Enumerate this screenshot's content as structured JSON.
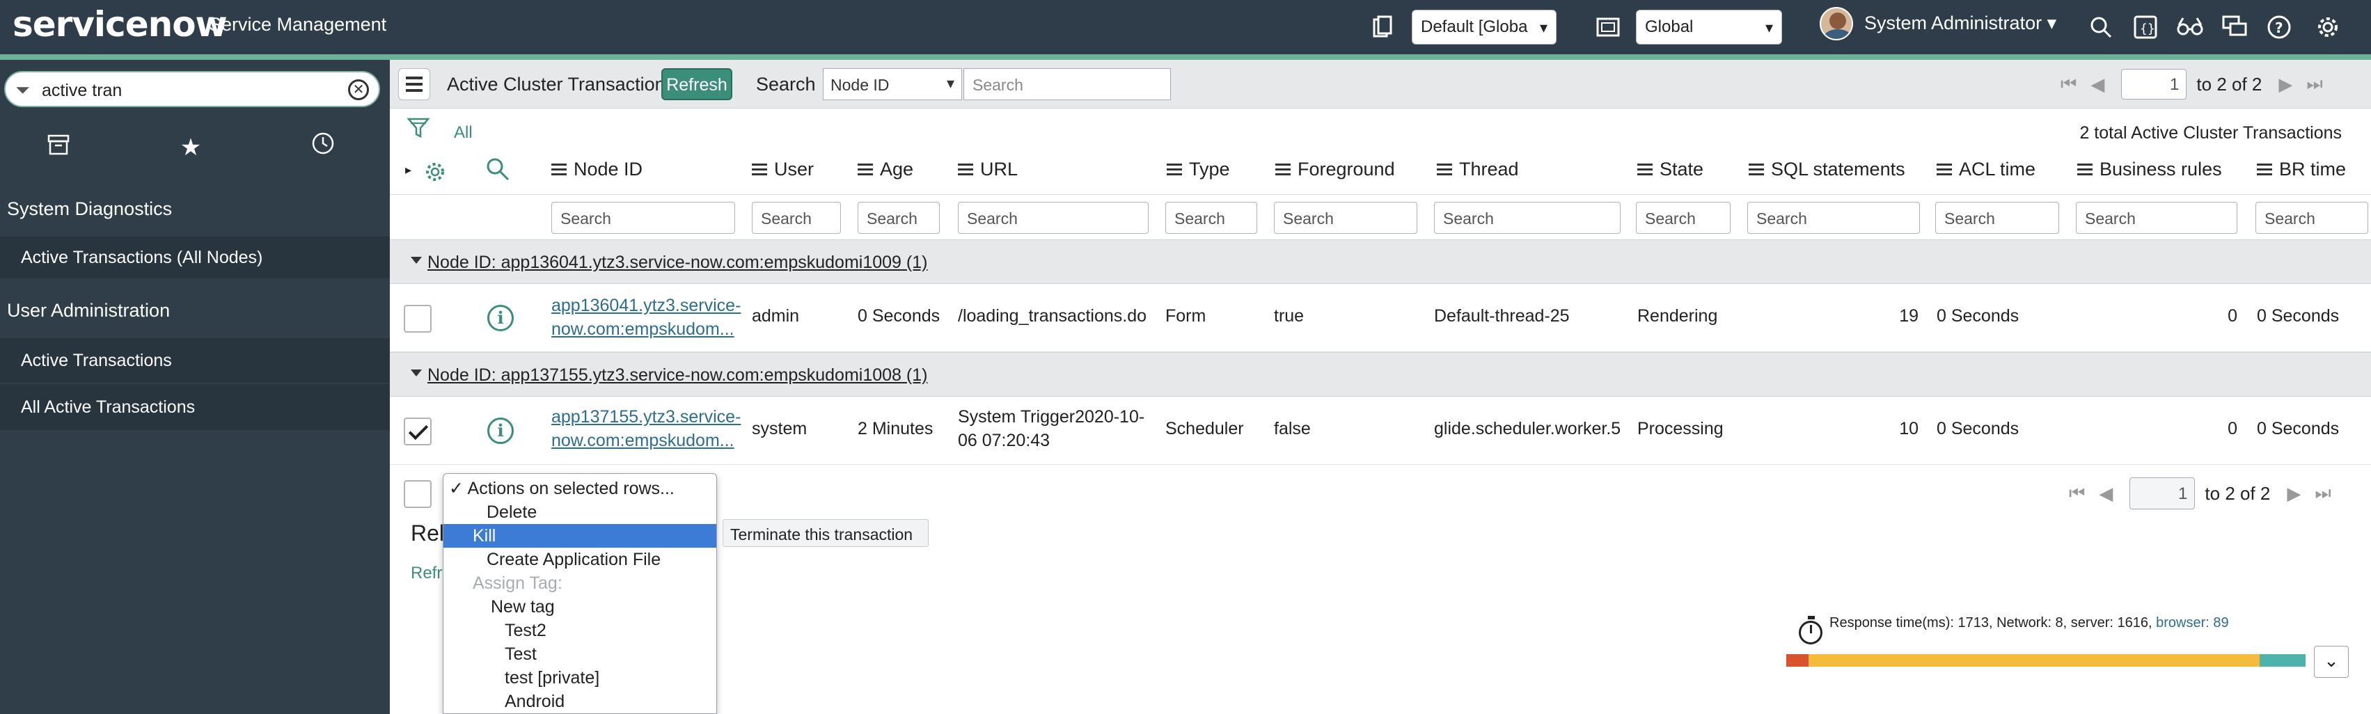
{
  "app": {
    "brand": "servicenow",
    "title": "Service Management",
    "update_set": "Default [Globa",
    "scope": "Global",
    "user": "System Administrator"
  },
  "sidebar": {
    "filter_value": "active tran",
    "sections": [
      {
        "label": "System Diagnostics",
        "modules": [
          "Active Transactions (All Nodes)"
        ]
      },
      {
        "label": "User Administration",
        "modules": [
          "Active Transactions",
          "All Active Transactions"
        ]
      }
    ]
  },
  "list": {
    "title": "Active Cluster Transactions",
    "refresh_label": "Refresh",
    "search_label": "Search",
    "search_field": "Node ID",
    "search_placeholder": "Search",
    "page_current": "1",
    "page_of": "to 2 of 2",
    "breadcrumb_all": "All",
    "total_text": "2   total Active Cluster Transactions",
    "columns": [
      "Node ID",
      "User",
      "Age",
      "URL",
      "Type",
      "Foreground",
      "Thread",
      "State",
      "SQL statements",
      "ACL time",
      "Business rules",
      "BR time"
    ],
    "column_search_placeholder": "Search",
    "groups": [
      {
        "label": "Node ID: app136041.ytz3.service-now.com:empskudomi1009 (1)",
        "row": {
          "checked": false,
          "node_id_line1": "app136041.ytz3.service-",
          "node_id_line2": "now.com:empskudom...",
          "user": "admin",
          "age": "0 Seconds",
          "url": "/loading_transactions.do",
          "url_line2": "",
          "type": "Form",
          "foreground": "true",
          "thread": "Default-thread-25",
          "state": "Rendering",
          "sql": "19",
          "acl": "0 Seconds",
          "business_rules": "0",
          "br_time": "0 Seconds"
        }
      },
      {
        "label": "Node ID: app137155.ytz3.service-now.com:empskudomi1008 (1)",
        "row": {
          "checked": true,
          "node_id_line1": "app137155.ytz3.service-",
          "node_id_line2": "now.com:empskudom...",
          "user": "system",
          "age": "2 Minutes",
          "url": "System Trigger2020-10-",
          "url_line2": "06 07:20:43",
          "type": "Scheduler",
          "foreground": "false",
          "thread": "glide.scheduler.worker.5",
          "state": "Processing",
          "sql": "10",
          "acl": "0 Seconds",
          "business_rules": "0",
          "br_time": "0 Seconds"
        }
      }
    ]
  },
  "actions_menu": {
    "items": [
      {
        "label": "Actions on selected rows...",
        "checked": true,
        "state": "normal"
      },
      {
        "label": "Delete",
        "state": "normal"
      },
      {
        "label": "Kill",
        "state": "selected"
      },
      {
        "label": "Create Application File",
        "state": "normal"
      },
      {
        "label": "Assign Tag:",
        "state": "disabled"
      },
      {
        "label": "New tag",
        "state": "normal"
      },
      {
        "label": "Test2",
        "state": "normal"
      },
      {
        "label": "Test",
        "state": "normal"
      },
      {
        "label": "test [private]",
        "state": "normal"
      },
      {
        "label": "Android",
        "state": "normal"
      }
    ],
    "tooltip": "Terminate this transaction"
  },
  "bottom": {
    "related_label": "Rela",
    "refresh_partial": "Refre",
    "page_current": "1",
    "page_of": "to 2 of 2"
  },
  "response_time": {
    "prefix": "Response time(ms): 1713, Network: 8, server: 1616, ",
    "browser": "browser: 89",
    "segments": [
      {
        "value": 8,
        "color": "#d9532c"
      },
      {
        "value": 1616,
        "color": "#f5bb3b"
      },
      {
        "value": 89,
        "color": "#4fb3ad"
      }
    ]
  },
  "colors": {
    "topbar": "#2e3d49",
    "accent": "#3b8f7a",
    "sidebar": "#303e4a",
    "selection": "#3c7bd6"
  }
}
